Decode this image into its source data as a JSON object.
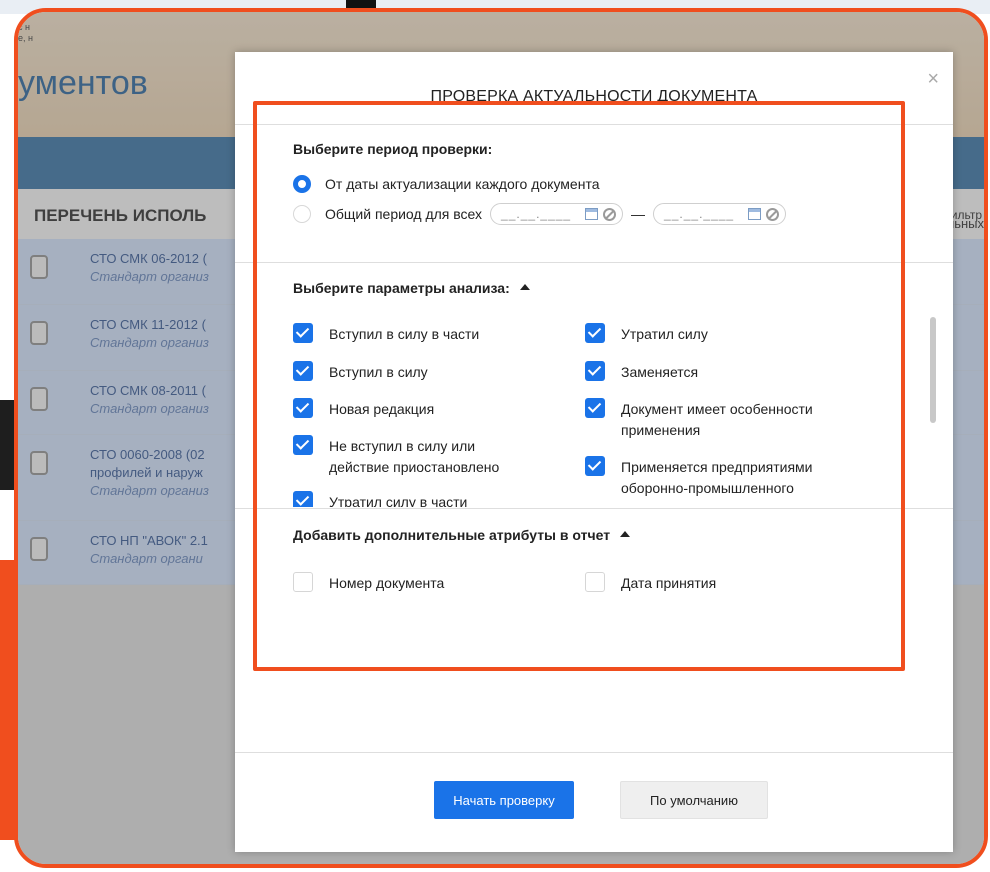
{
  "background": {
    "snippet_lines": [
      "с н",
      "е, н"
    ],
    "page_title": "ументов",
    "list_title": "ПЕРЕЧЕНЬ ИСПОЛЬ",
    "filter_label": "Фильтр",
    "right_fragment": "тальных",
    "rows": [
      {
        "line1": "СТО СМК 06-2012 (",
        "line2": "Стандарт организ",
        "line3": ""
      },
      {
        "line1": "СТО СМК 11-2012 (",
        "line2": "Стандарт организ",
        "line3": ""
      },
      {
        "line1": "СТО СМК 08-2011 (",
        "line2": "Стандарт организ",
        "line3": ""
      },
      {
        "line1": "СТО 0060-2008 (02",
        "line2": "профилей и наруж",
        "line3": "Стандарт организ"
      },
      {
        "line1": "СТО НП \"АВОК\" 2.1",
        "line2": "Стандарт органи",
        "line3": ""
      }
    ]
  },
  "modal": {
    "title": "ПРОВЕРКА АКТУАЛЬНОСТИ ДОКУМЕНТА",
    "close_symbol": "×",
    "period": {
      "heading": "Выберите период проверки:",
      "options": [
        {
          "label": "От даты актуализации каждого документа",
          "selected": true
        },
        {
          "label": "Общий период для всех",
          "selected": false
        }
      ],
      "date_from_mask": "__.__.____",
      "date_to_mask": "__.__.____",
      "separator": "—"
    },
    "analysis": {
      "heading": "Выберите параметры анализа:",
      "left": [
        {
          "label": "Вступил в силу в части",
          "checked": true
        },
        {
          "label": "Вступил в силу",
          "checked": true
        },
        {
          "label": "Новая редакция",
          "checked": true
        },
        {
          "label": "Не вступил в силу или действие приостановлено",
          "checked": true
        },
        {
          "label": "Утратил силу в части",
          "checked": true
        }
      ],
      "right": [
        {
          "label": "Утратил силу",
          "checked": true
        },
        {
          "label": "Заменяется",
          "checked": true
        },
        {
          "label": "Документ имеет особенности применения",
          "checked": true
        },
        {
          "label": "Применяется предприятиями оборонно-промышленного",
          "checked": true
        }
      ]
    },
    "attributes": {
      "heading": "Добавить дополнительные атрибуты в отчет",
      "items": [
        {
          "label": "Номер документа",
          "checked": false
        },
        {
          "label": "Дата принятия",
          "checked": false
        }
      ]
    },
    "buttons": {
      "start": "Начать проверку",
      "default": "По умолчанию"
    }
  },
  "colors": {
    "accent": "#1a73e8",
    "highlight": "#f04e1e"
  }
}
